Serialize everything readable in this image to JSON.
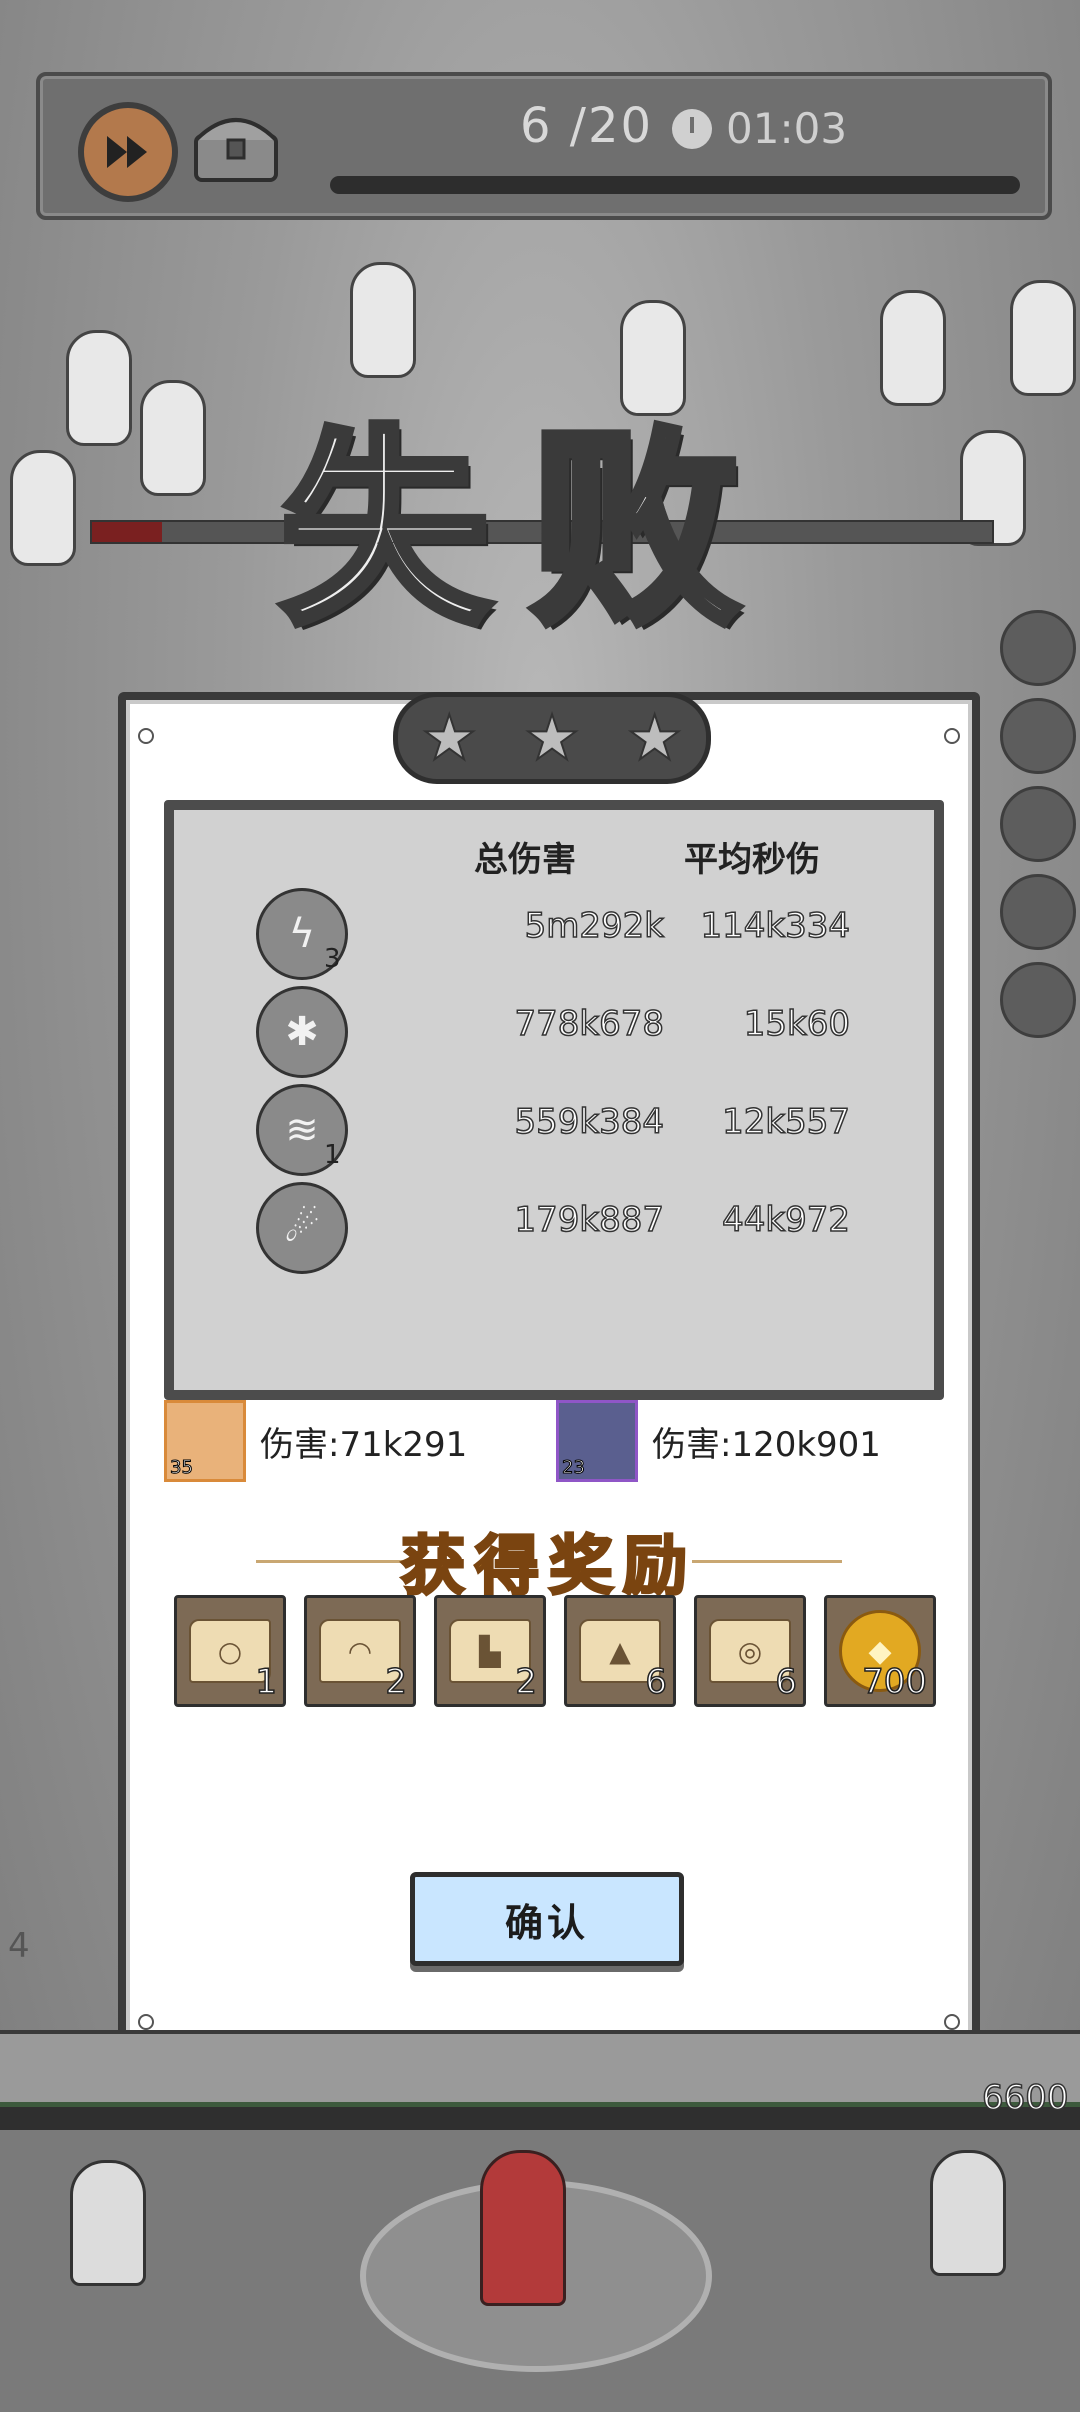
{
  "hud": {
    "wave_text": "6 /20",
    "timer": "01:03"
  },
  "result": {
    "title": "失败",
    "stars_earned": 0,
    "stars_total": 3
  },
  "stats": {
    "header_total": "总伤害",
    "header_avg": "平均秒伤",
    "rows": [
      {
        "icon": "lightning-skill-icon",
        "level": "3",
        "total": "5m292k",
        "avg": "114k334"
      },
      {
        "icon": "crystal-skill-icon",
        "level": "",
        "total": "778k678",
        "avg": "15k60"
      },
      {
        "icon": "tornado-skill-icon",
        "level": "1",
        "total": "559k384",
        "avg": "12k557"
      },
      {
        "icon": "meteor-skill-icon",
        "level": "",
        "total": "179k887",
        "avg": "44k972"
      }
    ]
  },
  "heroes": [
    {
      "level": "35",
      "damage": "伤害:71k291",
      "frame_color": "#d98a3a"
    },
    {
      "level": "23",
      "damage": "伤害:120k901",
      "frame_color": "#8f56c7"
    }
  ],
  "rewards": {
    "title": "获得奖励",
    "items": [
      {
        "icon": "necklace-scroll-icon",
        "qty": "1"
      },
      {
        "icon": "hat-scroll-icon",
        "qty": "2"
      },
      {
        "icon": "boots-scroll-icon",
        "qty": "2"
      },
      {
        "icon": "robe-scroll-icon",
        "qty": "6"
      },
      {
        "icon": "ring-scroll-icon",
        "qty": "6"
      },
      {
        "icon": "gold-coin-icon",
        "qty": "700"
      }
    ]
  },
  "confirm_label": "确认",
  "field": {
    "wall_hp": "6600",
    "left_counter": "4"
  },
  "colors": {
    "confirm_bg": "#c9e6ff",
    "reward_title": "#e6a64a"
  }
}
